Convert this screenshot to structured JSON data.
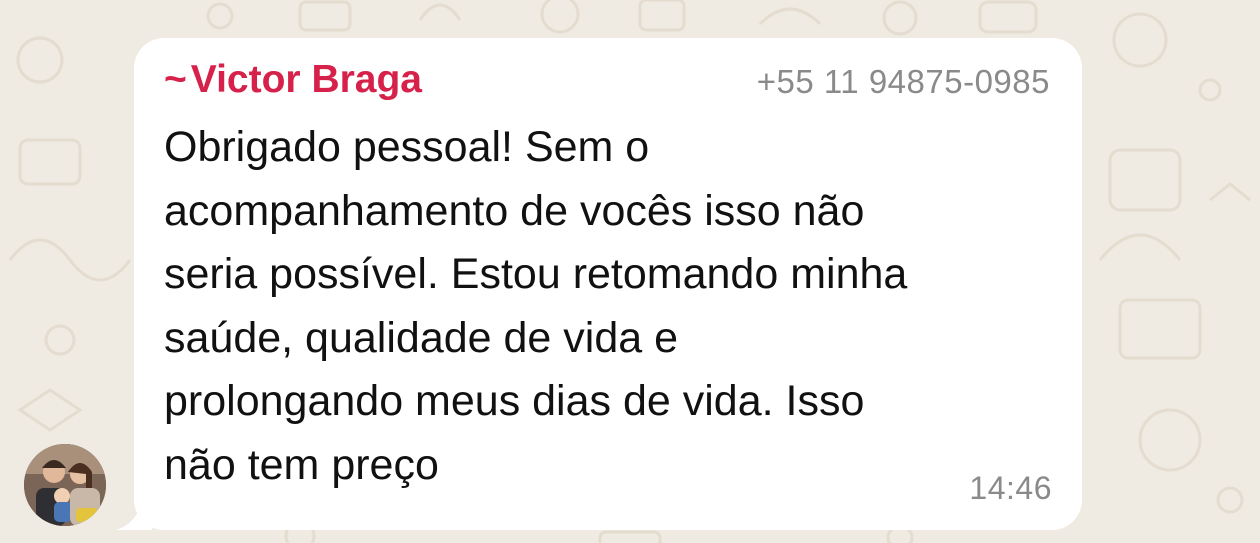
{
  "chat": {
    "message": {
      "sender_prefix": "~",
      "sender_name": "Victor Braga",
      "sender_phone": "+55 11 94875-0985",
      "text_lines": [
        "Obrigado pessoal! Sem o",
        "acompanhamento de vocês isso não",
        "seria possível. Estou retomando minha",
        "saúde, qualidade de vida e",
        "prolongando meus dias de vida. Isso",
        "não tem preço"
      ],
      "time": "14:46"
    }
  },
  "colors": {
    "background": "#efeae2",
    "bubble": "#ffffff",
    "sender_name": "#d6214a",
    "meta_text": "#8a8a8a",
    "message_text": "#111111"
  }
}
